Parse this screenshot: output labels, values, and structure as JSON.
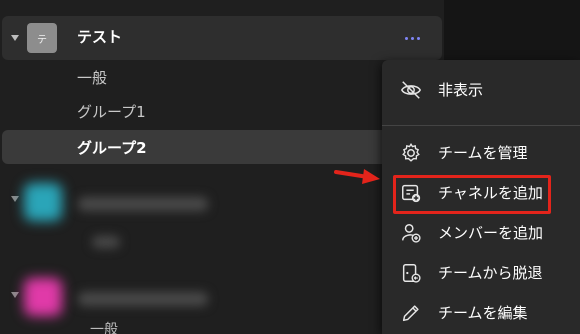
{
  "team": {
    "name": "テスト",
    "avatar_text": "テ"
  },
  "channels": [
    {
      "label": "一般",
      "selected": false
    },
    {
      "label": "グループ1",
      "selected": false
    },
    {
      "label": "グループ2",
      "selected": true
    }
  ],
  "blurred_teams": [
    {
      "avatar_color": "#2aa5b8",
      "channel_label": "一般"
    },
    {
      "avatar_color": "#e03aa8",
      "channel_label": "一般"
    }
  ],
  "context_menu": {
    "items": [
      {
        "label": "非表示",
        "icon": "eye-off-icon"
      },
      {
        "label": "チームを管理",
        "icon": "gear-icon"
      },
      {
        "label": "チャネルを追加",
        "icon": "add-channel-icon",
        "highlighted": true
      },
      {
        "label": "メンバーを追加",
        "icon": "add-person-icon"
      },
      {
        "label": "チームから脱退",
        "icon": "leave-door-icon"
      },
      {
        "label": "チームを編集",
        "icon": "pencil-icon"
      }
    ]
  },
  "colors": {
    "accent": "#7f85f5",
    "annotation": "#e3241b",
    "background": "#1f1f1f",
    "menu_background": "#292929"
  }
}
